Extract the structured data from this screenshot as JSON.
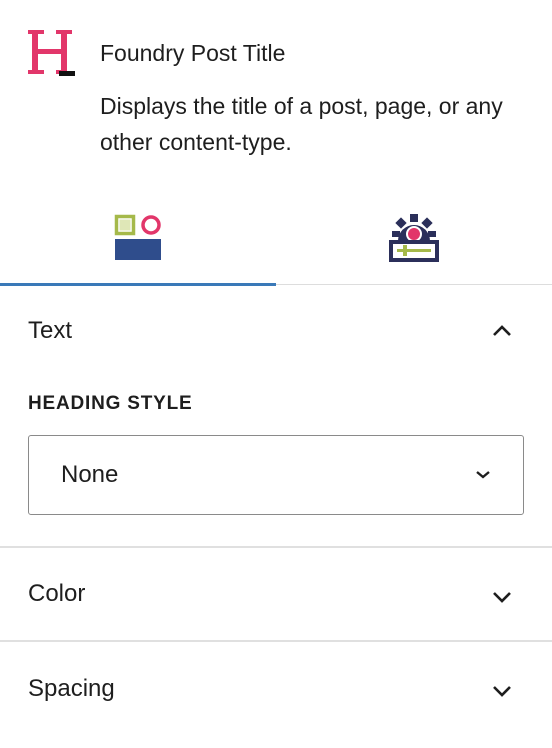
{
  "block": {
    "icon": "foundry-heading-icon",
    "title": "Foundry Post Title",
    "description": "Displays the title of a post, page, or any other content-type."
  },
  "tabs": [
    {
      "name": "styles",
      "icon": "styles-icon",
      "active": true
    },
    {
      "name": "settings",
      "icon": "settings-gear-icon",
      "active": false
    }
  ],
  "sections": {
    "text": {
      "title": "Text",
      "expanded": true,
      "heading_style": {
        "label": "HEADING STYLE",
        "value": "None"
      }
    },
    "color": {
      "title": "Color",
      "expanded": false
    },
    "spacing": {
      "title": "Spacing",
      "expanded": false
    }
  },
  "colors": {
    "brand_pink": "#e2366a",
    "navy": "#2f4d8c",
    "olive": "#a5b94a",
    "tab_indicator": "#3a79b8",
    "divider": "#e0e0e0",
    "text": "#1e1e1e"
  }
}
